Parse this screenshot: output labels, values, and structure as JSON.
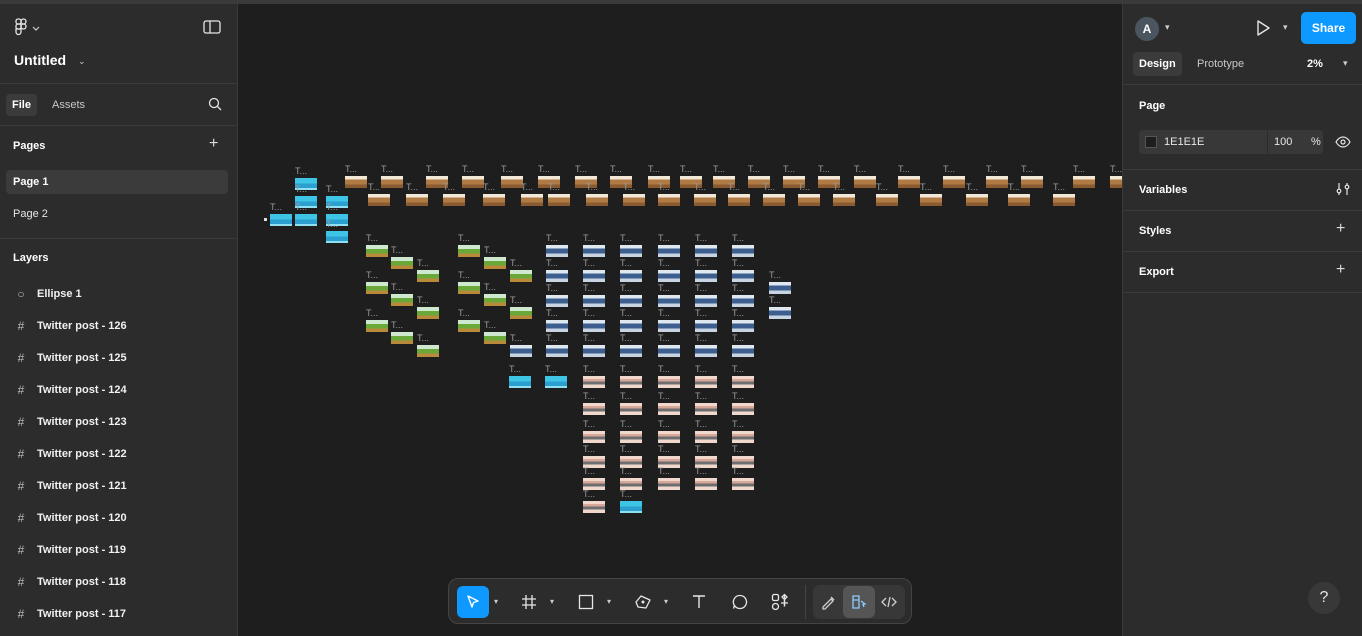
{
  "file": {
    "title": "Untitled"
  },
  "left_tabs": {
    "file": "File",
    "assets": "Assets"
  },
  "pages": {
    "heading": "Pages",
    "items": [
      "Page 1",
      "Page 2"
    ]
  },
  "layers": {
    "heading": "Layers",
    "items": [
      {
        "name": "Ellipse 1",
        "icon": "ellipse-icon"
      },
      {
        "name": "Twitter post - 126",
        "icon": "frame-icon"
      },
      {
        "name": "Twitter post - 125",
        "icon": "frame-icon"
      },
      {
        "name": "Twitter post - 124",
        "icon": "frame-icon"
      },
      {
        "name": "Twitter post - 123",
        "icon": "frame-icon"
      },
      {
        "name": "Twitter post - 122",
        "icon": "frame-icon"
      },
      {
        "name": "Twitter post - 121",
        "icon": "frame-icon"
      },
      {
        "name": "Twitter post - 120",
        "icon": "frame-icon"
      },
      {
        "name": "Twitter post - 119",
        "icon": "frame-icon"
      },
      {
        "name": "Twitter post - 118",
        "icon": "frame-icon"
      },
      {
        "name": "Twitter post - 117",
        "icon": "frame-icon"
      }
    ]
  },
  "right": {
    "avatar": "A",
    "share": "Share",
    "tabs": {
      "design": "Design",
      "prototype": "Prototype"
    },
    "zoom": "2%",
    "page_section": "Page",
    "page_color": "1E1E1E",
    "page_opacity": "100",
    "percent": "%",
    "variables": "Variables",
    "styles": "Styles",
    "export": "Export",
    "help": "?"
  },
  "canvas": {
    "frame_label": "T..."
  },
  "colors": {
    "accent": "#0d99ff",
    "panel": "#2c2c2c",
    "canvas": "#1e1e1e"
  }
}
